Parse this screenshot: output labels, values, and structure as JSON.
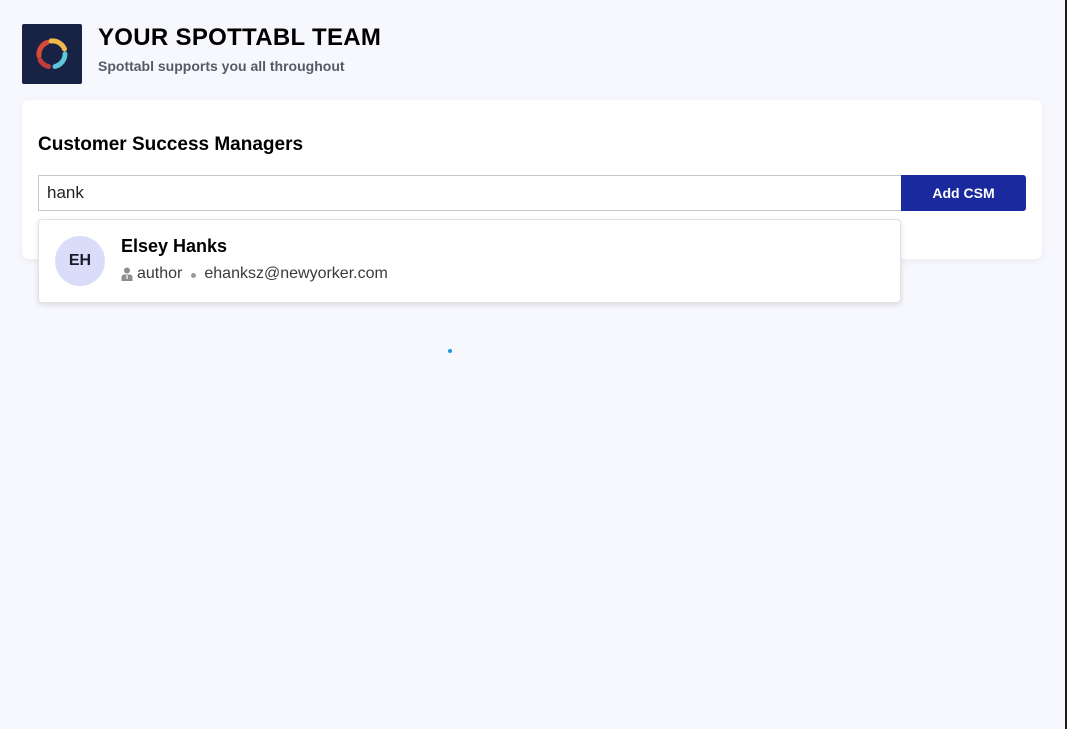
{
  "header": {
    "title": "YOUR SPOTTABL TEAM",
    "subtitle": "Spottabl supports you all throughout",
    "logo_icon": "spottabl-logo-icon"
  },
  "csm_section": {
    "title": "Customer Success Managers",
    "search_value": "hank",
    "add_button_label": "Add CSM"
  },
  "search_results": [
    {
      "initials": "EH",
      "name": "Elsey Hanks",
      "role": "author",
      "email": "ehanksz@newyorker.com"
    }
  ],
  "colors": {
    "page_background": "#f7f8fd",
    "logo_background": "#172245",
    "button_primary": "#1a2a9e",
    "avatar_background": "#d9ddf9",
    "loader": "#1f9ad6"
  }
}
